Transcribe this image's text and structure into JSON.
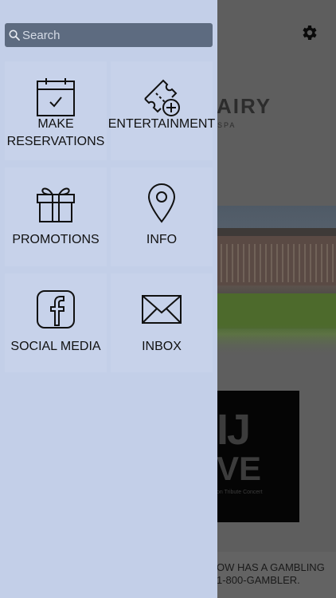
{
  "search": {
    "placeholder": "Search"
  },
  "menu": {
    "items": [
      {
        "label": "MAKE RESERVATIONS",
        "icon": "calendar-check-icon"
      },
      {
        "label": "ENTERTAINMENT",
        "icon": "ticket-plus-icon"
      },
      {
        "label": "PROMOTIONS",
        "icon": "gift-icon"
      },
      {
        "label": "INFO",
        "icon": "map-pin-icon"
      },
      {
        "label": "SOCIAL MEDIA",
        "icon": "facebook-icon"
      },
      {
        "label": "INBOX",
        "icon": "envelope-icon"
      }
    ]
  },
  "background": {
    "logo_text": "AIRY",
    "logo_sub": "SPA",
    "poster_line1": "IJ",
    "poster_line2": "VE",
    "poster_caption": "on Tribute Concert",
    "footer_line1": "OW HAS A GAMBLING",
    "footer_line2": "1-800-GAMBLER."
  },
  "colors": {
    "drawer_bg": "#c3cfe8",
    "search_bg": "#5d6b80",
    "icon_stroke": "#111111"
  }
}
